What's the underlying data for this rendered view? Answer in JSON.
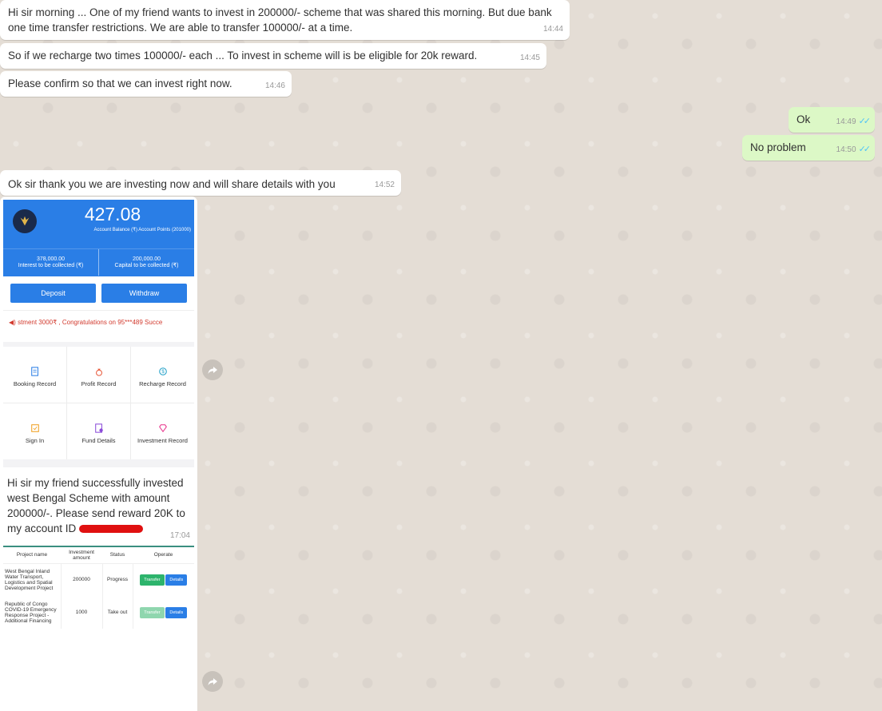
{
  "messages": {
    "m1": {
      "text": "Hi sir morning ... One of my friend wants to invest in 200000/- scheme that was shared this morning. But due bank one time transfer restrictions. We are able to transfer 100000/- at a time.",
      "time": "14:44"
    },
    "m2": {
      "text": "So if we recharge two times 100000/- each ... To invest in scheme will is be eligible for 20k reward.",
      "time": "14:45"
    },
    "m3": {
      "text": "Please confirm so that we can invest right now.",
      "time": "14:46"
    },
    "m4": {
      "text": "Ok",
      "time": "14:49"
    },
    "m5": {
      "text": "No problem",
      "time": "14:50"
    },
    "m6": {
      "text": "Ok sir thank you we are investing now and will share details with you",
      "time": "14:52"
    },
    "m7": {
      "text_line1": "Hi sir my friend successfully invested west Bengal Scheme with amount 200000/-. Please send reward 20K to my account ID ",
      "time": "17:04"
    }
  },
  "screenshot1": {
    "balance": "427.08",
    "balance_sub": "Account Balance (₹) Account Points (201000)",
    "interest_value": "378,000.00",
    "interest_label": "Interest to be collected (₹)",
    "capital_value": "200,000.00",
    "capital_label": "Capital to be collected (₹)",
    "deposit": "Deposit",
    "withdraw": "Withdraw",
    "marquee": "stment 3000₹ , Congratulations on 95***489 Succe",
    "grid": [
      {
        "label": "Booking Record",
        "icon": "booking-record-icon"
      },
      {
        "label": "Profit Record",
        "icon": "money-bag-icon"
      },
      {
        "label": "Recharge Record",
        "icon": "recharge-icon"
      },
      {
        "label": "Sign In",
        "icon": "sign-in-icon"
      },
      {
        "label": "Fund Details",
        "icon": "fund-details-icon"
      },
      {
        "label": "Investment Record",
        "icon": "diamond-icon"
      }
    ]
  },
  "screenshot2": {
    "headers": [
      "Project name",
      "Investment amount",
      "Status",
      "Operate"
    ],
    "rows": [
      {
        "name": "West Bengal Inland Water Transport, Logistics and Spatial Development Project",
        "amount": "200000",
        "status": "Progress",
        "transfer": "Transfer",
        "details": "Details"
      },
      {
        "name": "Republic of Congo COVID-19 Emergency Response Project - Additional Financing",
        "amount": "1000",
        "status": "Take out",
        "transfer": "Transfer",
        "details": "Details"
      }
    ]
  },
  "colors": {
    "incoming": "#ffffff",
    "outgoing": "#dcf8c6",
    "app_blue": "#2a7ee6",
    "ticks": "#4fc3f7"
  }
}
